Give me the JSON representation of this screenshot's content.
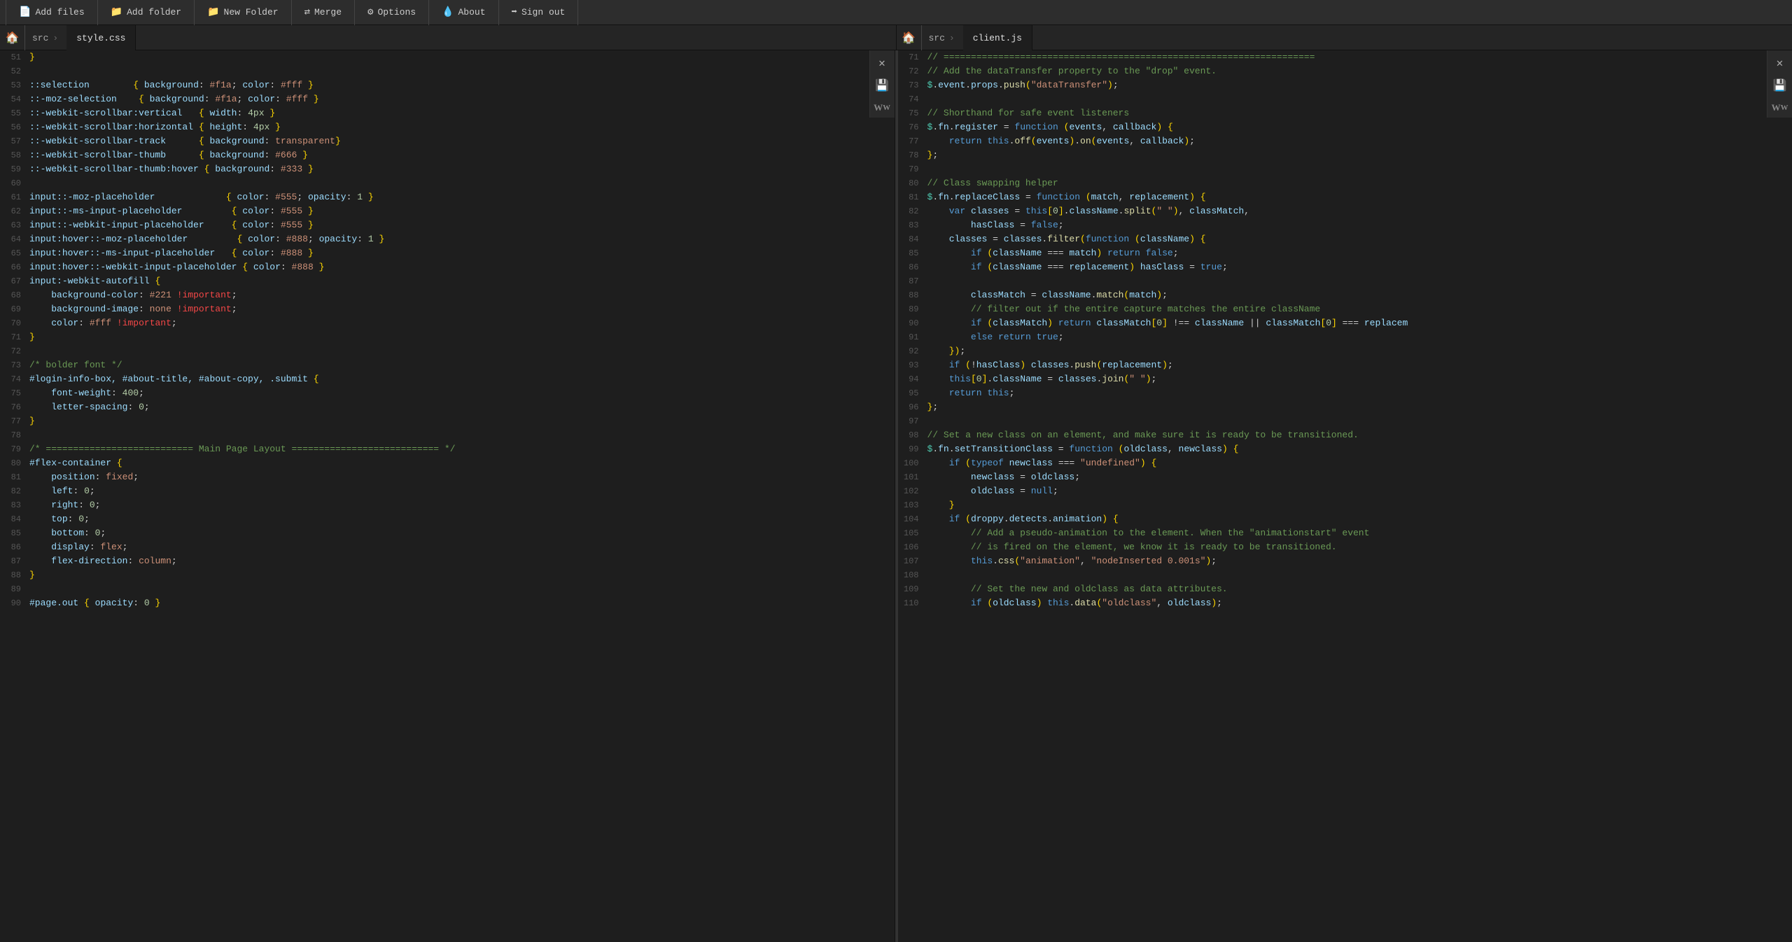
{
  "toolbar": {
    "buttons": [
      {
        "id": "add-files",
        "icon": "📄",
        "label": "Add files"
      },
      {
        "id": "add-folder",
        "icon": "📁",
        "label": "Add folder"
      },
      {
        "id": "new-folder",
        "icon": "📁",
        "label": "New Folder"
      },
      {
        "id": "merge",
        "icon": "🔀",
        "label": "Merge"
      },
      {
        "id": "options",
        "icon": "⚙",
        "label": "Options"
      },
      {
        "id": "about",
        "icon": "💧",
        "label": "About"
      },
      {
        "id": "sign-out",
        "icon": "➡",
        "label": "Sign out"
      }
    ]
  },
  "panes": [
    {
      "id": "left",
      "breadcrumb": "src",
      "tab": "style.css"
    },
    {
      "id": "right",
      "breadcrumb": "src",
      "tab": "client.js"
    }
  ],
  "side_buttons": {
    "close": "✕",
    "save": "💾",
    "wrap": "Ww"
  }
}
